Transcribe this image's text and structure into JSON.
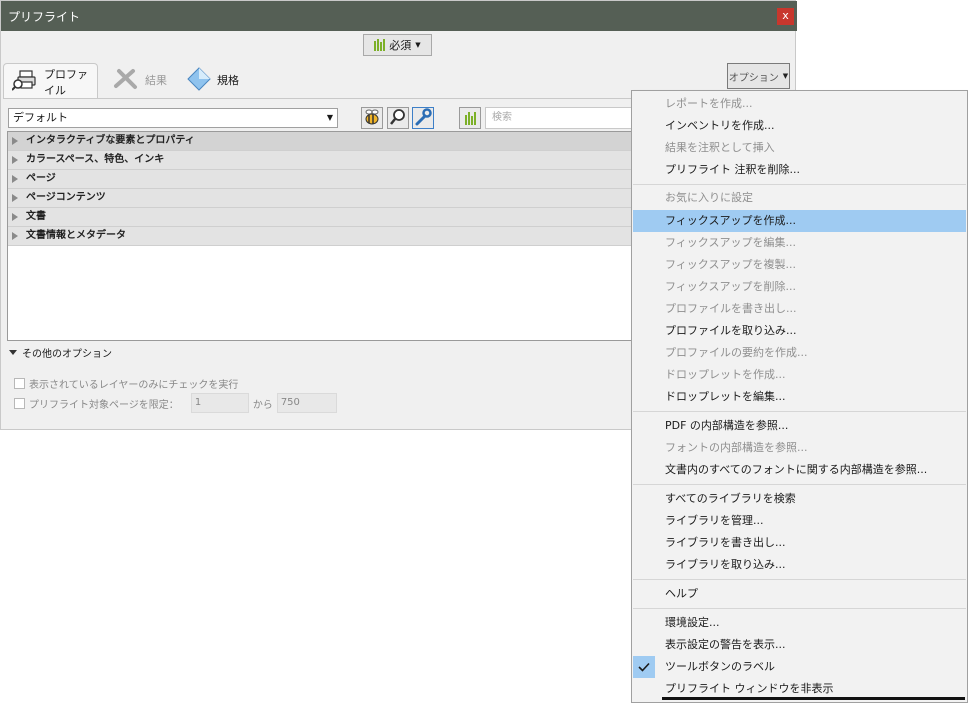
{
  "window": {
    "title": "プリフライト",
    "close_label": "x"
  },
  "required_button": {
    "label": "必須"
  },
  "tabs": [
    {
      "label": "プロファイル"
    },
    {
      "label": "結果"
    },
    {
      "label": "規格"
    }
  ],
  "options_button": {
    "label": "オプション"
  },
  "profile_select": {
    "value": "デフォルト"
  },
  "search": {
    "placeholder": "検索"
  },
  "tree_items": [
    "インタラクティブな要素とプロパティ",
    "カラースペース、特色、インキ",
    "ページ",
    "ページコンテンツ",
    "文書",
    "文書情報とメタデータ"
  ],
  "other_options": {
    "label": "その他のオプション",
    "visible_layers_label": "表示されているレイヤーのみにチェックを実行",
    "page_range_label": "プリフライト対象ページを限定：",
    "from_value": "1",
    "to_label": "から",
    "to_value": "750"
  },
  "menu_items": [
    {
      "label": "レポートを作成...",
      "enabled": false
    },
    {
      "label": "インベントリを作成...",
      "enabled": true
    },
    {
      "label": "結果を注釈として挿入",
      "enabled": false
    },
    {
      "label": "プリフライト 注釈を削除...",
      "enabled": true
    },
    {
      "label": "お気に入りに設定",
      "enabled": false
    },
    {
      "label": "フィックスアップを作成...",
      "enabled": true,
      "highlighted": true
    },
    {
      "label": "フィックスアップを編集...",
      "enabled": false
    },
    {
      "label": "フィックスアップを複製...",
      "enabled": false
    },
    {
      "label": "フィックスアップを削除...",
      "enabled": false
    },
    {
      "label": "プロファイルを書き出し...",
      "enabled": false
    },
    {
      "label": "プロファイルを取り込み...",
      "enabled": true
    },
    {
      "label": "プロファイルの要約を作成...",
      "enabled": false
    },
    {
      "label": "ドロップレットを作成...",
      "enabled": false
    },
    {
      "label": "ドロップレットを編集...",
      "enabled": true
    },
    {
      "label": "PDF の内部構造を参照...",
      "enabled": true
    },
    {
      "label": "フォントの内部構造を参照...",
      "enabled": false
    },
    {
      "label": "文書内のすべてのフォントに関する内部構造を参照...",
      "enabled": true
    },
    {
      "label": "すべてのライブラリを検索",
      "enabled": true
    },
    {
      "label": "ライブラリを管理...",
      "enabled": true
    },
    {
      "label": "ライブラリを書き出し...",
      "enabled": true
    },
    {
      "label": "ライブラリを取り込み...",
      "enabled": true
    },
    {
      "label": "ヘルプ",
      "enabled": true
    },
    {
      "label": "環境設定...",
      "enabled": true
    },
    {
      "label": "表示設定の警告を表示...",
      "enabled": true
    },
    {
      "label": "ツールボタンのラベル",
      "enabled": true,
      "checked": true
    },
    {
      "label": "プリフライト ウィンドウを非表示",
      "enabled": true
    }
  ],
  "colors": {
    "titlebar": "#555f55",
    "close": "#c8372d",
    "highlight": "#9fcbf2",
    "accent_green": "#7cb028"
  }
}
